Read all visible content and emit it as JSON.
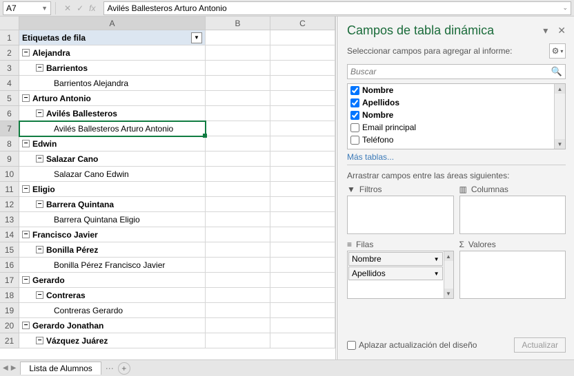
{
  "namebox": {
    "ref": "A7"
  },
  "fx": {
    "value": "Avilés Ballesteros Arturo Antonio"
  },
  "columns": {
    "A": "A",
    "B": "B",
    "C": "C"
  },
  "rows": [
    {
      "n": 1,
      "type": "header",
      "text": "Etiquetas de fila"
    },
    {
      "n": 2,
      "type": "l0",
      "text": "Alejandra"
    },
    {
      "n": 3,
      "type": "l1",
      "text": "Barrientos"
    },
    {
      "n": 4,
      "type": "l2",
      "text": "Barrientos Alejandra"
    },
    {
      "n": 5,
      "type": "l0",
      "text": "Arturo Antonio"
    },
    {
      "n": 6,
      "type": "l1",
      "text": "Avilés Ballesteros"
    },
    {
      "n": 7,
      "type": "l2",
      "text": "Avilés Ballesteros Arturo Antonio",
      "selected": true
    },
    {
      "n": 8,
      "type": "l0",
      "text": "Edwin"
    },
    {
      "n": 9,
      "type": "l1",
      "text": "Salazar Cano"
    },
    {
      "n": 10,
      "type": "l2",
      "text": "Salazar Cano Edwin"
    },
    {
      "n": 11,
      "type": "l0",
      "text": "Eligio"
    },
    {
      "n": 12,
      "type": "l1",
      "text": "Barrera Quintana"
    },
    {
      "n": 13,
      "type": "l2",
      "text": "Barrera Quintana Eligio"
    },
    {
      "n": 14,
      "type": "l0",
      "text": "Francisco Javier"
    },
    {
      "n": 15,
      "type": "l1",
      "text": "Bonilla Pérez"
    },
    {
      "n": 16,
      "type": "l2",
      "text": "Bonilla Pérez Francisco Javier"
    },
    {
      "n": 17,
      "type": "l0",
      "text": "Gerardo"
    },
    {
      "n": 18,
      "type": "l1",
      "text": "Contreras"
    },
    {
      "n": 19,
      "type": "l2",
      "text": "Contreras Gerardo"
    },
    {
      "n": 20,
      "type": "l0",
      "text": "Gerardo Jonathan"
    },
    {
      "n": 21,
      "type": "l1",
      "text": "Vázquez Juárez"
    }
  ],
  "sheettab": {
    "name": "Lista de Alumnos"
  },
  "panel": {
    "title": "Campos de tabla dinámica",
    "subtitle": "Seleccionar campos para agregar al informe:",
    "search_placeholder": "Buscar",
    "fields": [
      {
        "label": "Nombre",
        "checked": true
      },
      {
        "label": "Apellidos",
        "checked": true
      },
      {
        "label": "Nombre",
        "checked": true
      },
      {
        "label": "Email principal",
        "checked": false
      },
      {
        "label": "Teléfono",
        "checked": false
      }
    ],
    "more_tables": "Más tablas...",
    "drag_hint": "Arrastrar campos entre las áreas siguientes:",
    "area_filters": "Filtros",
    "area_columns": "Columnas",
    "area_rows": "Filas",
    "area_values": "Valores",
    "rows_items": [
      "Nombre",
      "Apellidos"
    ],
    "defer_label": "Aplazar actualización del diseño",
    "update_btn": "Actualizar"
  }
}
